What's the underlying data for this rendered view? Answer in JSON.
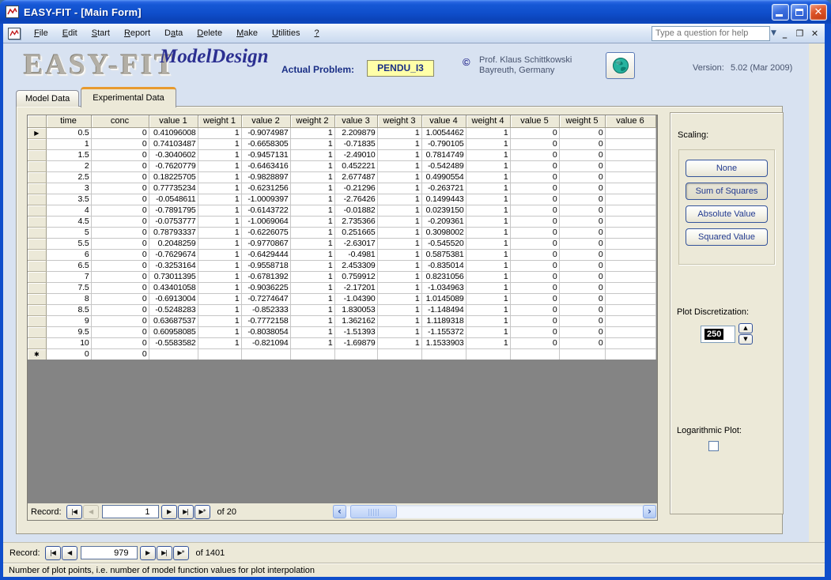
{
  "window": {
    "title": "EASY-FIT - [Main Form]"
  },
  "menubar": {
    "items": [
      {
        "label": "File",
        "u": 0
      },
      {
        "label": "Edit",
        "u": 0
      },
      {
        "label": "Start",
        "u": 0
      },
      {
        "label": "Report",
        "u": 0
      },
      {
        "label": "Data",
        "u": 1
      },
      {
        "label": "Delete",
        "u": 0
      },
      {
        "label": "Make",
        "u": 0
      },
      {
        "label": "Utilities",
        "u": 0
      },
      {
        "label": "?",
        "u": 0
      }
    ],
    "help_placeholder": "Type a question for help"
  },
  "header": {
    "logo": "EASY-FIT",
    "brand": "ModelDesign",
    "actual_problem_label": "Actual Problem:",
    "actual_problem_value": "PENDU_I3",
    "copyright_symbol": "©",
    "author_line1": "Prof. Klaus Schittkowski",
    "author_line2": "Bayreuth, Germany",
    "version_label": "Version:",
    "version_value": "5.02 (Mar 2009)"
  },
  "tabs": [
    {
      "label": "Model Data"
    },
    {
      "label": "Experimental Data"
    }
  ],
  "table": {
    "columns": [
      "time",
      "conc",
      "value 1",
      "weight 1",
      "value 2",
      "weight 2",
      "value 3",
      "weight 3",
      "value 4",
      "weight 4",
      "value 5",
      "weight 5",
      "value 6"
    ],
    "current_marker": "▶",
    "new_marker": "✱",
    "rows": [
      [
        "0.5",
        "0",
        "0.41096008",
        "1",
        "-0.9074987",
        "1",
        "2.209879",
        "1",
        "1.0054462",
        "1",
        "0",
        "0",
        ""
      ],
      [
        "1",
        "0",
        "0.74103487",
        "1",
        "-0.6658305",
        "1",
        "-0.71835",
        "1",
        "-0.790105",
        "1",
        "0",
        "0",
        ""
      ],
      [
        "1.5",
        "0",
        "-0.3040602",
        "1",
        "-0.9457131",
        "1",
        "-2.49010",
        "1",
        "0.7814749",
        "1",
        "0",
        "0",
        ""
      ],
      [
        "2",
        "0",
        "-0.7620779",
        "1",
        "-0.6463416",
        "1",
        "0.452221",
        "1",
        "-0.542489",
        "1",
        "0",
        "0",
        ""
      ],
      [
        "2.5",
        "0",
        "0.18225705",
        "1",
        "-0.9828897",
        "1",
        "2.677487",
        "1",
        "0.4990554",
        "1",
        "0",
        "0",
        ""
      ],
      [
        "3",
        "0",
        "0.77735234",
        "1",
        "-0.6231256",
        "1",
        "-0.21296",
        "1",
        "-0.263721",
        "1",
        "0",
        "0",
        ""
      ],
      [
        "3.5",
        "0",
        "-0.0548611",
        "1",
        "-1.0009397",
        "1",
        "-2.76426",
        "1",
        "0.1499443",
        "1",
        "0",
        "0",
        ""
      ],
      [
        "4",
        "0",
        "-0.7891795",
        "1",
        "-0.6143722",
        "1",
        "-0.01882",
        "1",
        "0.0239150",
        "1",
        "0",
        "0",
        ""
      ],
      [
        "4.5",
        "0",
        "-0.0753777",
        "1",
        "-1.0069064",
        "1",
        "2.735366",
        "1",
        "-0.209361",
        "1",
        "0",
        "0",
        ""
      ],
      [
        "5",
        "0",
        "0.78793337",
        "1",
        "-0.6226075",
        "1",
        "0.251665",
        "1",
        "0.3098002",
        "1",
        "0",
        "0",
        ""
      ],
      [
        "5.5",
        "0",
        "0.2048259",
        "1",
        "-0.9770867",
        "1",
        "-2.63017",
        "1",
        "-0.545520",
        "1",
        "0",
        "0",
        ""
      ],
      [
        "6",
        "0",
        "-0.7629674",
        "1",
        "-0.6429444",
        "1",
        "-0.4981",
        "1",
        "0.5875381",
        "1",
        "0",
        "0",
        ""
      ],
      [
        "6.5",
        "0",
        "-0.3253164",
        "1",
        "-0.9558718",
        "1",
        "2.453309",
        "1",
        "-0.835014",
        "1",
        "0",
        "0",
        ""
      ],
      [
        "7",
        "0",
        "0.73011395",
        "1",
        "-0.6781392",
        "1",
        "0.759912",
        "1",
        "0.8231056",
        "1",
        "0",
        "0",
        ""
      ],
      [
        "7.5",
        "0",
        "0.43401058",
        "1",
        "-0.9036225",
        "1",
        "-2.17201",
        "1",
        "-1.034963",
        "1",
        "0",
        "0",
        ""
      ],
      [
        "8",
        "0",
        "-0.6913004",
        "1",
        "-0.7274647",
        "1",
        "-1.04390",
        "1",
        "1.0145089",
        "1",
        "0",
        "0",
        ""
      ],
      [
        "8.5",
        "0",
        "-0.5248283",
        "1",
        "-0.852333",
        "1",
        "1.830053",
        "1",
        "-1.148494",
        "1",
        "0",
        "0",
        ""
      ],
      [
        "9",
        "0",
        "0.63687537",
        "1",
        "-0.7772158",
        "1",
        "1.362162",
        "1",
        "1.1189318",
        "1",
        "0",
        "0",
        ""
      ],
      [
        "9.5",
        "0",
        "0.60958085",
        "1",
        "-0.8038054",
        "1",
        "-1.51393",
        "1",
        "-1.155372",
        "1",
        "0",
        "0",
        ""
      ],
      [
        "10",
        "0",
        "-0.5583582",
        "1",
        "-0.821094",
        "1",
        "-1.69879",
        "1",
        "1.1533903",
        "1",
        "0",
        "0",
        ""
      ]
    ],
    "new_row": [
      "0",
      "0",
      "",
      "",
      "",
      "",
      "",
      "",
      "",
      "",
      "",
      "",
      ""
    ]
  },
  "nav_icons": {
    "first": "|◀",
    "prev": "◀",
    "next": "▶",
    "last": "▶|",
    "new_rec": "▶*"
  },
  "record_nav_grid": {
    "label": "Record:",
    "value": "1",
    "of": "of 20"
  },
  "record_nav_form": {
    "label": "Record:",
    "value": "979",
    "of": "of 1401"
  },
  "panel": {
    "scaling_label": "Scaling:",
    "scaling_buttons": [
      "None",
      "Sum of Squares",
      "Absolute Value",
      "Squared Value"
    ],
    "plot_discretization_label": "Plot Discretization:",
    "plot_discretization_value": "250",
    "logarithmic_label": "Logarithmic Plot:"
  },
  "statusbar": {
    "text": "Number of plot points, i.e. number of model function values for plot interpolation"
  },
  "colors": {
    "title_blue": "#0f4ecb",
    "panel_beige": "#ECE9D8",
    "problem_yellow": "#ffffa8",
    "tab_accent_orange": "#e89a2e",
    "grid_gray": "#848484"
  }
}
